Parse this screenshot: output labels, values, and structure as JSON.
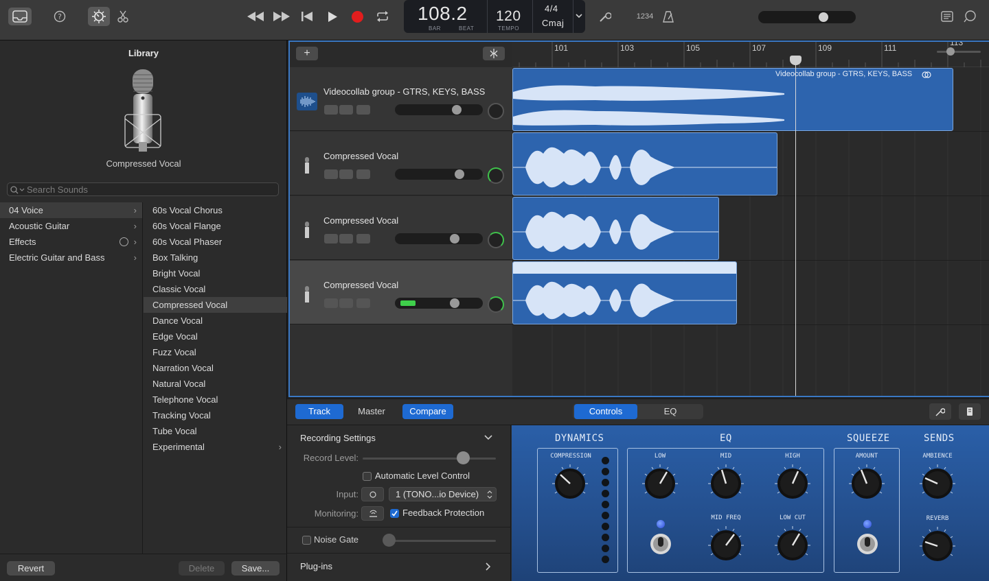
{
  "toolbar": {
    "icons": [
      "library-icon",
      "help-icon",
      "smart-controls-icon",
      "scissors-icon",
      "rewind-icon",
      "fast-forward-icon",
      "to-start-icon",
      "play-icon",
      "record-icon",
      "cycle-icon",
      "tuner-icon",
      "count-in-icon",
      "metronome-icon",
      "notepad-icon",
      "loop-browser-icon"
    ],
    "lcd": {
      "position": "108.2",
      "bar_label": "BAR",
      "beat_label": "BEAT",
      "tempo": "120",
      "tempo_label": "TEMPO",
      "time_signature": "4/4",
      "key": "Cmaj"
    },
    "count_in": "1234",
    "record_color": "#e21d1d"
  },
  "library": {
    "title": "Library",
    "patch_name": "Compressed Vocal",
    "search_placeholder": "Search Sounds",
    "categories": [
      {
        "label": "04 Voice",
        "selected": true
      },
      {
        "label": "Acoustic Guitar"
      },
      {
        "label": "Effects"
      },
      {
        "label": "Electric Guitar and Bass"
      }
    ],
    "patches": [
      "60s Vocal Chorus",
      "60s Vocal Flange",
      "60s Vocal Phaser",
      "Box Talking",
      "Bright Vocal",
      "Classic Vocal",
      "Compressed Vocal",
      "Dance Vocal",
      "Edge Vocal",
      "Fuzz Vocal",
      "Narration Vocal",
      "Natural Vocal",
      "Telephone Vocal",
      "Tracking Vocal",
      "Tube Vocal",
      "Experimental"
    ],
    "selected_patch": "Compressed Vocal",
    "buttons": {
      "revert": "Revert",
      "delete": "Delete",
      "save": "Save..."
    }
  },
  "tracks": {
    "add_label": "+",
    "ruler_bars": [
      "101",
      "103",
      "105",
      "107",
      "109",
      "111",
      "113"
    ],
    "list": [
      {
        "name": "Videocollab group - GTRS, KEYS, BASS",
        "volume": 0.71,
        "type": "group"
      },
      {
        "name": "Compressed Vocal",
        "volume": 0.74,
        "type": "vocal"
      },
      {
        "name": "Compressed Vocal",
        "volume": 0.68,
        "type": "vocal"
      },
      {
        "name": "Compressed Vocal",
        "volume": 0.68,
        "type": "vocal",
        "selected": true
      }
    ],
    "group_region_label": "Videocollab group - GTRS, KEYS, BASS"
  },
  "editor": {
    "tabs_left": {
      "track": "Track",
      "master": "Master",
      "compare": "Compare"
    },
    "tabs_right": {
      "controls": "Controls",
      "eq": "EQ"
    },
    "recording": {
      "title": "Recording Settings",
      "record_level_label": "Record Level:",
      "alc_label": "Automatic Level Control",
      "input_label": "Input:",
      "input_value": "1 (TONO...io Device)",
      "monitoring_label": "Monitoring:",
      "feedback_label": "Feedback Protection",
      "noise_gate_label": "Noise Gate",
      "plugins_label": "Plug-ins"
    },
    "controls": {
      "dynamics": "DYNAMICS",
      "compression": "COMPRESSION",
      "eq": "EQ",
      "low": "LOW",
      "mid": "MID",
      "high": "HIGH",
      "mid_freq": "MID FREQ",
      "low_cut": "LOW CUT",
      "squeeze": "SQUEEZE",
      "amount": "AMOUNT",
      "sends": "SENDS",
      "ambience": "AMBIENCE",
      "reverb": "REVERB"
    }
  }
}
